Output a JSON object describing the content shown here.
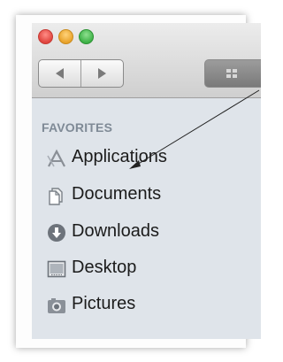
{
  "window": {
    "traffic_lights": [
      "close",
      "minimize",
      "zoom"
    ],
    "toolbar": {
      "back_icon": "back-arrow-icon",
      "forward_icon": "forward-arrow-icon",
      "view_icon": "icon-view-grid-icon"
    }
  },
  "sidebar": {
    "section_title": "FAVORITES",
    "items": [
      {
        "label": "Applications",
        "icon": "applications-icon"
      },
      {
        "label": "Documents",
        "icon": "documents-icon"
      },
      {
        "label": "Downloads",
        "icon": "downloads-icon"
      },
      {
        "label": "Desktop",
        "icon": "desktop-icon"
      },
      {
        "label": "Pictures",
        "icon": "pictures-icon"
      }
    ]
  },
  "colors": {
    "sidebar_bg": "#dfe4ea",
    "section_header": "#7f8a96",
    "close": "#e0443e",
    "minimize": "#e9a32b",
    "zoom": "#3eb247"
  },
  "annotation": {
    "icon": "pointer-arrow"
  }
}
